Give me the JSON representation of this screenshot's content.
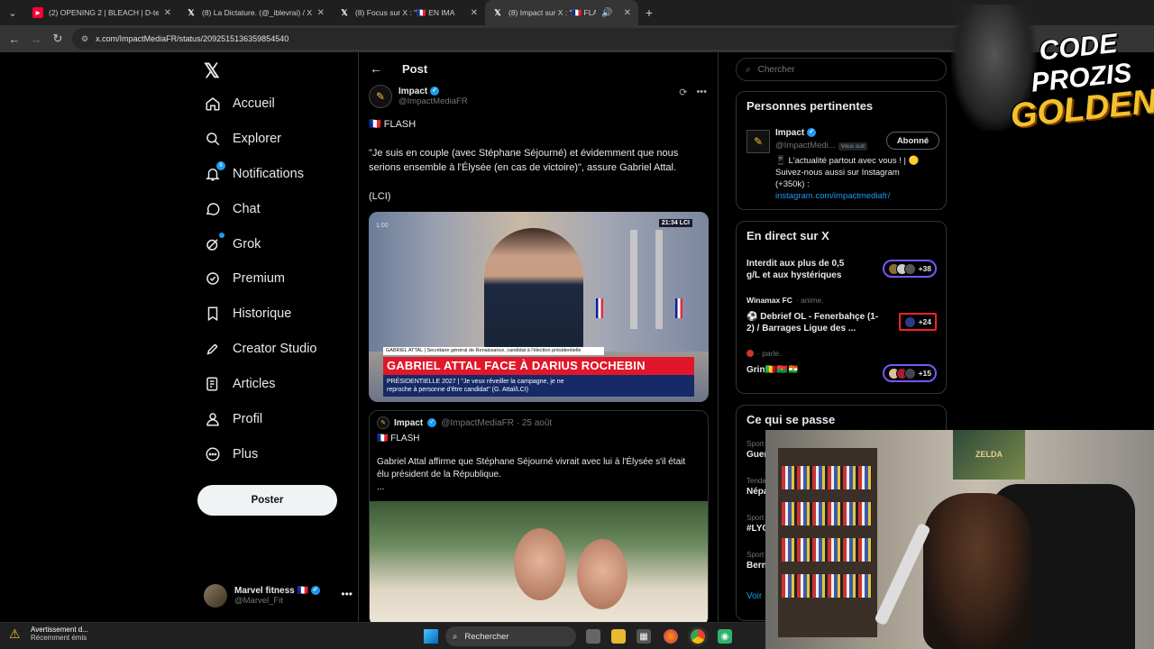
{
  "browser": {
    "tabs": [
      {
        "title": "(2) OPENING 2 | BLEACH | D-te",
        "icon": "youtube-icon",
        "active": false
      },
      {
        "title": "(8) La Dictature. (@_iblevrai) / X",
        "icon": "x-icon",
        "active": false
      },
      {
        "title": "(8) Focus sur X : \"🇫🇷 EN IMA",
        "icon": "x-icon",
        "active": false
      },
      {
        "title": "(8) Impact sur X : \"🇫🇷 FLASH",
        "icon": "x-icon",
        "active": true
      }
    ],
    "new_tab": "+",
    "url": "x.com/ImpactMediaFR/status/2092515136359854540"
  },
  "sidebar": {
    "logo": "𝕏",
    "items": [
      {
        "label": "Accueil",
        "icon": "home-icon"
      },
      {
        "label": "Explorer",
        "icon": "search-icon"
      },
      {
        "label": "Notifications",
        "icon": "bell-icon",
        "badge": "8"
      },
      {
        "label": "Chat",
        "icon": "chat-icon"
      },
      {
        "label": "Grok",
        "icon": "grok-icon"
      },
      {
        "label": "Premium",
        "icon": "premium-icon"
      },
      {
        "label": "Historique",
        "icon": "bookmark-icon"
      },
      {
        "label": "Creator Studio",
        "icon": "rocket-icon"
      },
      {
        "label": "Articles",
        "icon": "articles-icon"
      },
      {
        "label": "Profil",
        "icon": "profile-icon"
      },
      {
        "label": "Plus",
        "icon": "more-circle-icon"
      }
    ],
    "post_button": "Poster",
    "account": {
      "name": "Marvel fitness 🇫🇷",
      "handle": "@Marvel_Fit"
    }
  },
  "main": {
    "header_title": "Post",
    "tweet": {
      "author_name": "Impact",
      "author_handle": "@ImpactMediaFR",
      "flash": "🇫🇷 FLASH",
      "quote_line1": "\"Je suis en couple (avec Stéphane Séjourné) et évidemment que nous",
      "quote_line2": "serions ensemble à l'Élysée (en cas de victoire)\", assure Gabriel Attal.",
      "source": "(LCI)",
      "media": {
        "channel": "LCI",
        "clock": "21:34",
        "timestamp": "1:00",
        "banner_small": "GABRIEL ATTAL | Secrétaire général de Renaissance, candidat à l'élection présidentielle",
        "banner_main": "GABRIEL ATTAL FACE À DARIUS ROCHEBIN",
        "banner_sub1": "PRÉSIDENTIELLE 2027 | \"Je veux réveiller la campagne, je ne",
        "banner_sub2": "reproche à personne d'être candidat\" (G. Attal/LCI)"
      }
    },
    "quoted": {
      "author_name": "Impact",
      "meta": "@ImpactMediaFR · 25 août",
      "flash": "🇫🇷 FLASH",
      "line1": "Gabriel Attal affirme que Stéphane Séjourné vivrait avec lui à l'Élysée s'il était",
      "line2": "élu président de la République.",
      "line3": "..."
    }
  },
  "right": {
    "search_placeholder": "Chercher",
    "relevant": {
      "title": "Personnes pertinentes",
      "name": "Impact",
      "handle": "@ImpactMedi...",
      "follows_you": "Vous suit",
      "button": "Abonné",
      "bio1": "📱 L'actualité partout avec vous ! | 🟡",
      "bio2": "Suivez-nous aussi sur Instagram",
      "bio3": "(+350k) :",
      "link": "instagram.com/impactmediafr/"
    },
    "live": {
      "title": "En direct sur X",
      "items": [
        {
          "title1": "Interdit aux plus de 0,5",
          "title2": "g/L et aux hystériques",
          "count": "+38"
        },
        {
          "host": "Winamax FC",
          "host_suffix": "· anime.",
          "title1": "⚽ Debrief OL - Fenerbahçe (1-",
          "title2": "2) / Barrages Ligue des ...",
          "count": "+24"
        },
        {
          "host": "· parle.",
          "title1": "Grin🇲🇱🇧🇫🇳🇪",
          "count": "+15"
        }
      ]
    },
    "whats_happening": {
      "title": "Ce qui se passe",
      "items": [
        {
          "category": "Sport",
          "name": "Guer"
        },
        {
          "category": "Tenda",
          "name": "Népa"
        },
        {
          "category": "Sport",
          "name": "#LYO"
        },
        {
          "category": "Sport",
          "name": "Bern"
        }
      ],
      "more": "Voir"
    }
  },
  "overlay": {
    "logo_line1": "CODE PROZIS",
    "logo_line2": "GOLDENG",
    "poster_text": "ZELDA"
  },
  "taskbar": {
    "alert_title": "Avertissement d...",
    "alert_sub": "Récemment émis",
    "search_label": "Rechercher"
  }
}
